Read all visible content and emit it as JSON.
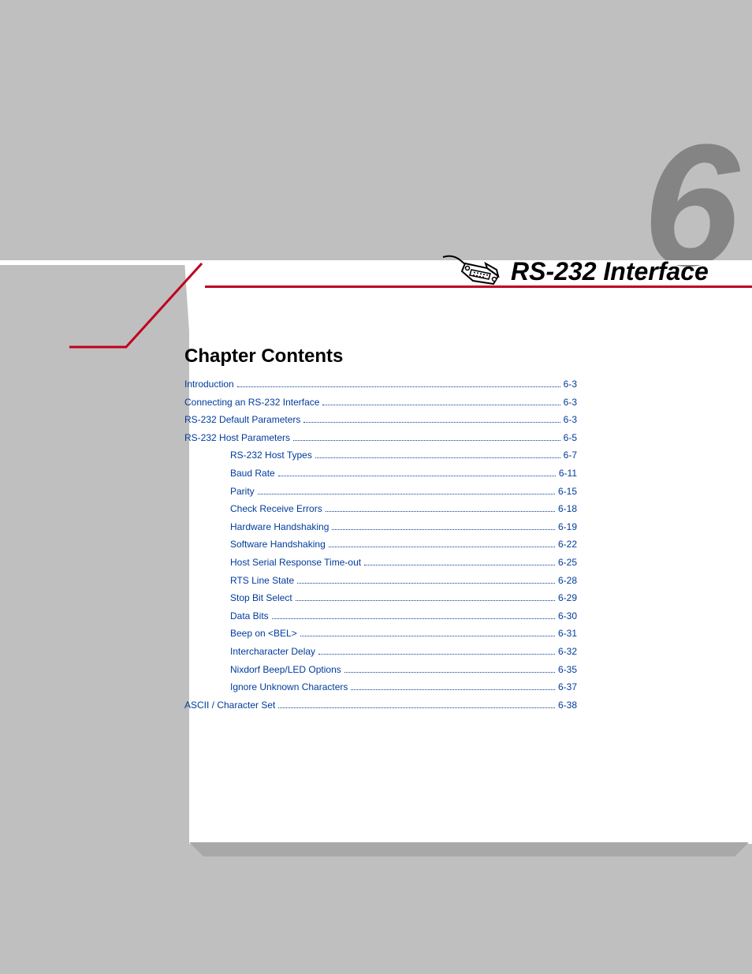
{
  "chapter": {
    "number": "6",
    "title": "RS-232 Interface"
  },
  "contents_heading": "Chapter Contents",
  "toc": [
    {
      "label": "Introduction",
      "page": "6-3",
      "indent": 0
    },
    {
      "label": "Connecting an RS-232 Interface",
      "page": "6-3",
      "indent": 0
    },
    {
      "label": "RS-232 Default Parameters",
      "page": "6-3",
      "indent": 0
    },
    {
      "label": "RS-232 Host Parameters",
      "page": "6-5",
      "indent": 0
    },
    {
      "label": "RS-232 Host Types",
      "page": "6-7",
      "indent": 1
    },
    {
      "label": "Baud Rate",
      "page": "6-11",
      "indent": 1
    },
    {
      "label": "Parity",
      "page": "6-15",
      "indent": 1
    },
    {
      "label": "Check Receive Errors",
      "page": "6-18",
      "indent": 1
    },
    {
      "label": "Hardware Handshaking",
      "page": "6-19",
      "indent": 1
    },
    {
      "label": "Software Handshaking",
      "page": "6-22",
      "indent": 1
    },
    {
      "label": "Host Serial Response Time-out",
      "page": "6-25",
      "indent": 1
    },
    {
      "label": "RTS Line State",
      "page": "6-28",
      "indent": 1
    },
    {
      "label": "Stop Bit Select",
      "page": "6-29",
      "indent": 1
    },
    {
      "label": "Data Bits",
      "page": "6-30",
      "indent": 1
    },
    {
      "label": "Beep on <BEL>",
      "page": "6-31",
      "indent": 1
    },
    {
      "label": "Intercharacter Delay",
      "page": "6-32",
      "indent": 1
    },
    {
      "label": "Nixdorf Beep/LED Options",
      "page": "6-35",
      "indent": 1
    },
    {
      "label": "Ignore Unknown Characters",
      "page": "6-37",
      "indent": 1
    },
    {
      "label": "ASCII / Character Set",
      "page": "6-38",
      "indent": 0
    }
  ]
}
